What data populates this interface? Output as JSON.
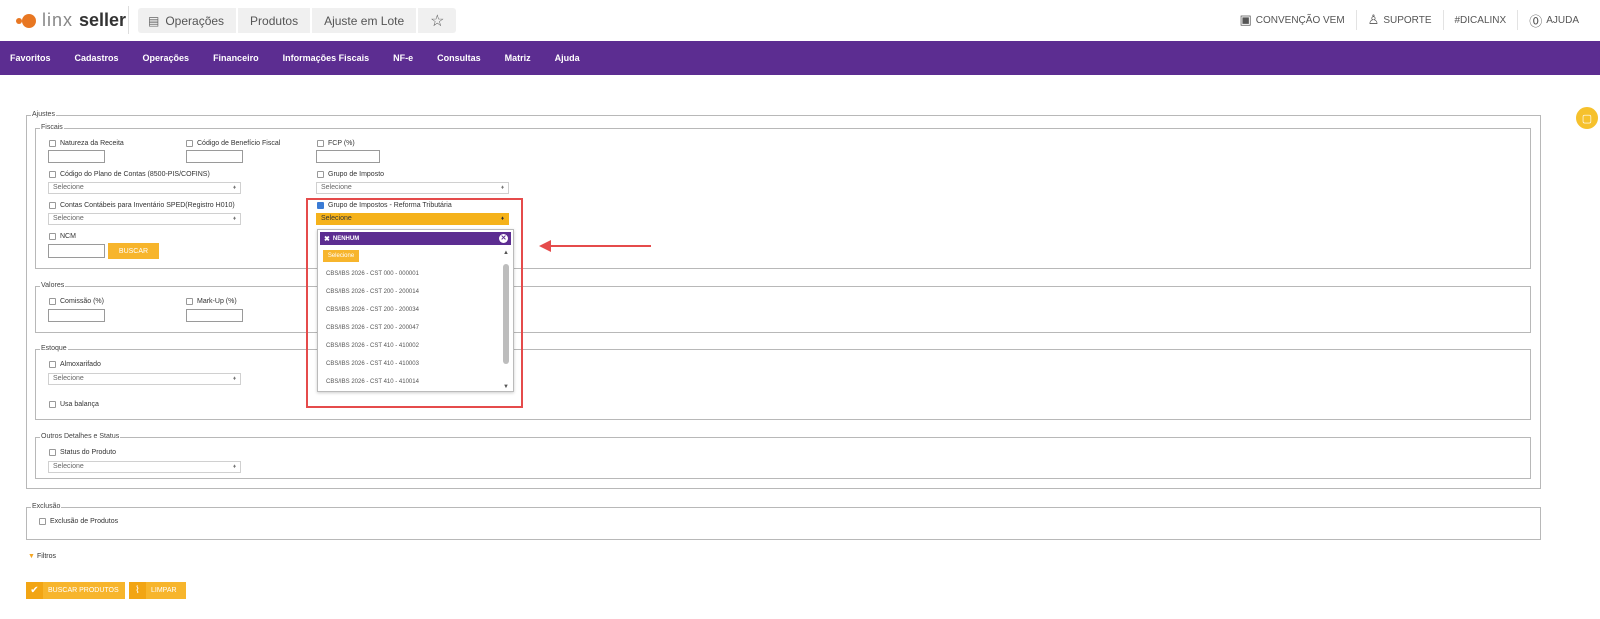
{
  "header": {
    "logo_light": "linx",
    "logo_bold": "seller",
    "breadcrumbs": [
      "Operações",
      "Produtos",
      "Ajuste em Lote"
    ],
    "links": [
      "CONVENÇÃO VEM",
      "SUPORTE",
      "#DICALINX",
      "AJUDA"
    ]
  },
  "menu": [
    "Favoritos",
    "Cadastros",
    "Operações",
    "Financeiro",
    "Informações Fiscais",
    "NF-e",
    "Consultas",
    "Matriz",
    "Ajuda"
  ],
  "form": {
    "ajustes_legend": "Ajustes",
    "fiscais": {
      "legend": "Fiscais",
      "natureza": "Natureza da Receita",
      "codigo_beneficio": "Código de Benefício Fiscal",
      "fcp": "FCP (%)",
      "plano_contas": "Código do Plano de Contas (8500-PIS/COFINS)",
      "plano_contas_value": "Selecione",
      "grupo_imposto": "Grupo de Imposto",
      "grupo_imposto_value": "Selecione",
      "contas_contabeis": "Contas Contábeis para Inventário SPED(Registro H010)",
      "contas_contabeis_value": "Selecione",
      "grupo_reforma": "Grupo de Impostos - Reforma Tributária",
      "grupo_reforma_value": "Selecione",
      "ncm": "NCM",
      "buscar": "BUSCAR"
    },
    "valores": {
      "legend": "Valores",
      "comissao": "Comissão (%)",
      "markup": "Mark-Up (%)"
    },
    "estoque": {
      "legend": "Estoque",
      "almoxarifado": "Almoxarifado",
      "almoxarifado_value": "Selecione",
      "usa_balanca": "Usa balança"
    },
    "outros": {
      "legend": "Outros Detalhes e Status",
      "status": "Status do Produto",
      "status_value": "Selecione"
    },
    "exclusao": {
      "legend": "Exclusão",
      "exclusao_produtos": "Exclusão de Produtos"
    }
  },
  "dropdown": {
    "header": "NENHUM",
    "selected": "Selecione",
    "options": [
      "CBS/IBS 2026 - CST 000 - 000001",
      "CBS/IBS 2026 - CST 200 - 200014",
      "CBS/IBS 2026 - CST 200 - 200034",
      "CBS/IBS 2026 - CST 200 - 200047",
      "CBS/IBS 2026 - CST 410 - 410002",
      "CBS/IBS 2026 - CST 410 - 410003",
      "CBS/IBS 2026 - CST 410 - 410014"
    ]
  },
  "filtros": "Filtros",
  "actions": {
    "buscar_produtos": "BUSCAR PRODUTOS",
    "limpar": "LIMPAR"
  },
  "colors": {
    "purple": "#5c2d91",
    "yellow": "#f7b52c",
    "highlight": "#e54b4b"
  }
}
